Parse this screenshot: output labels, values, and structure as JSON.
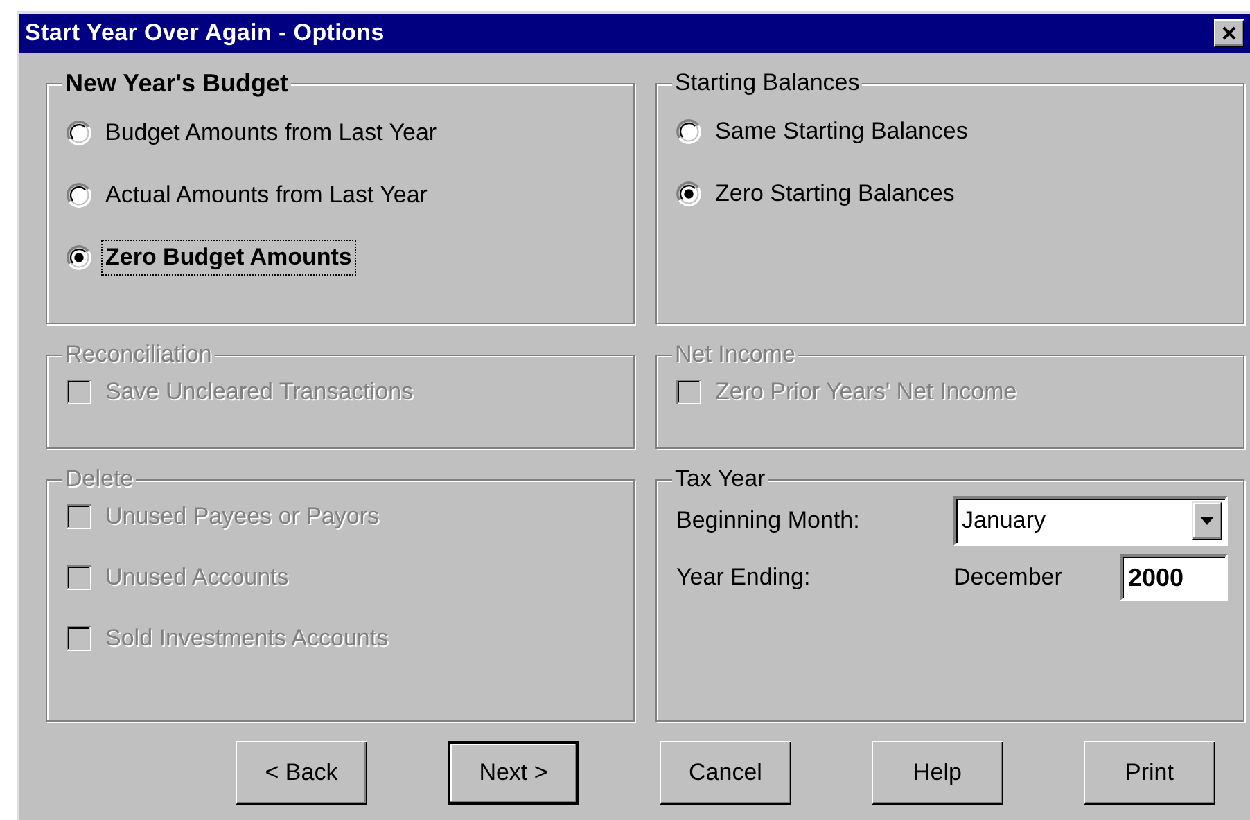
{
  "window": {
    "title": "Start Year Over Again - Options"
  },
  "groups": [
    {
      "kind": "radio",
      "title": "New Year's Budget",
      "emphasized": true,
      "disabled": false,
      "options": [
        {
          "label": "Budget Amounts from Last Year",
          "selected": false,
          "focused": false
        },
        {
          "label": "Actual Amounts from Last Year",
          "selected": false,
          "focused": false
        },
        {
          "label": "Zero Budget Amounts",
          "selected": true,
          "focused": true
        }
      ]
    },
    {
      "kind": "radio",
      "title": "Starting Balances",
      "emphasized": false,
      "disabled": false,
      "options": [
        {
          "label": "Same Starting Balances",
          "selected": false,
          "focused": false
        },
        {
          "label": "Zero Starting Balances",
          "selected": true,
          "focused": false
        }
      ]
    },
    {
      "kind": "checkbox",
      "title": "Reconciliation",
      "emphasized": false,
      "disabled": true,
      "items": [
        {
          "label": "Save Uncleared Transactions",
          "checked": false
        }
      ]
    },
    {
      "kind": "checkbox",
      "title": "Net Income",
      "emphasized": false,
      "disabled": true,
      "items": [
        {
          "label": "Zero Prior Years' Net Income",
          "checked": false
        }
      ]
    },
    {
      "kind": "checkbox",
      "title": "Delete",
      "emphasized": false,
      "disabled": true,
      "items": [
        {
          "label": "Unused Payees or Payors",
          "checked": false
        },
        {
          "label": "Unused Accounts",
          "checked": false
        },
        {
          "label": "Sold Investments Accounts",
          "checked": false
        }
      ]
    },
    {
      "kind": "tax",
      "title": "Tax Year",
      "emphasized": false,
      "disabled": false,
      "beginning_month_label": "Beginning Month:",
      "beginning_month": "January",
      "year_ending_label": "Year Ending:",
      "year_ending_month": "December",
      "year_ending_year": "2000"
    }
  ],
  "buttons": [
    {
      "label": "< Back",
      "default": false
    },
    {
      "label": "Next >",
      "default": true
    },
    {
      "label": "Cancel",
      "default": false
    },
    {
      "label": "Help",
      "default": false
    },
    {
      "label": "Print",
      "default": false
    }
  ]
}
